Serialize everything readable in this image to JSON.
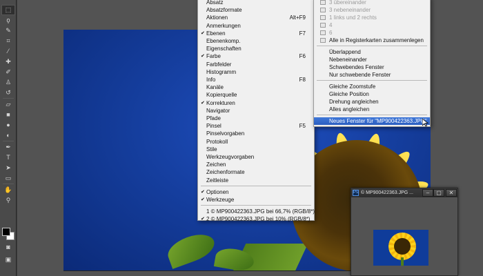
{
  "toolbar": {
    "tools": [
      {
        "name": "marquee-tool-icon",
        "glyph": "⬚"
      },
      {
        "name": "lasso-tool-icon",
        "glyph": "ϙ"
      },
      {
        "name": "quick-select-tool-icon",
        "glyph": "✎"
      },
      {
        "name": "crop-tool-icon",
        "glyph": "⌗"
      },
      {
        "name": "eyedropper-tool-icon",
        "glyph": "⁄"
      },
      {
        "name": "healing-brush-tool-icon",
        "glyph": "✚"
      },
      {
        "name": "brush-tool-icon",
        "glyph": "✐"
      },
      {
        "name": "clone-stamp-tool-icon",
        "glyph": "♙"
      },
      {
        "name": "history-brush-tool-icon",
        "glyph": "↺"
      },
      {
        "name": "eraser-tool-icon",
        "glyph": "▱"
      },
      {
        "name": "gradient-tool-icon",
        "glyph": "■"
      },
      {
        "name": "blur-tool-icon",
        "glyph": "●"
      },
      {
        "name": "dodge-tool-icon",
        "glyph": "◐"
      },
      {
        "name": "pen-tool-icon",
        "glyph": "✒"
      },
      {
        "name": "type-tool-icon",
        "glyph": "T"
      },
      {
        "name": "path-selection-tool-icon",
        "glyph": "➤"
      },
      {
        "name": "shape-tool-icon",
        "glyph": "▭"
      },
      {
        "name": "hand-tool-icon",
        "glyph": "✋"
      },
      {
        "name": "zoom-tool-icon",
        "glyph": "⚲"
      }
    ],
    "bottom_tools": [
      {
        "name": "quick-mask-icon",
        "glyph": "◙"
      },
      {
        "name": "screen-mode-icon",
        "glyph": "▣"
      }
    ]
  },
  "window_menu": {
    "items": [
      {
        "label": "Absatz",
        "shortcut": "",
        "checked": false
      },
      {
        "label": "Absatzformate",
        "shortcut": "",
        "checked": false
      },
      {
        "label": "Aktionen",
        "shortcut": "Alt+F9",
        "checked": false
      },
      {
        "label": "Anmerkungen",
        "shortcut": "",
        "checked": false
      },
      {
        "label": "Ebenen",
        "shortcut": "F7",
        "checked": true
      },
      {
        "label": "Ebenenkomp.",
        "shortcut": "",
        "checked": false
      },
      {
        "label": "Eigenschaften",
        "shortcut": "",
        "checked": false
      },
      {
        "label": "Farbe",
        "shortcut": "F6",
        "checked": true
      },
      {
        "label": "Farbfelder",
        "shortcut": "",
        "checked": false
      },
      {
        "label": "Histogramm",
        "shortcut": "",
        "checked": false
      },
      {
        "label": "Info",
        "shortcut": "F8",
        "checked": false
      },
      {
        "label": "Kanäle",
        "shortcut": "",
        "checked": false
      },
      {
        "label": "Kopierquelle",
        "shortcut": "",
        "checked": false
      },
      {
        "label": "Korrekturen",
        "shortcut": "",
        "checked": true
      },
      {
        "label": "Navigator",
        "shortcut": "",
        "checked": false
      },
      {
        "label": "Pfade",
        "shortcut": "",
        "checked": false
      },
      {
        "label": "Pinsel",
        "shortcut": "F5",
        "checked": false
      },
      {
        "label": "Pinselvorgaben",
        "shortcut": "",
        "checked": false
      },
      {
        "label": "Protokoll",
        "shortcut": "",
        "checked": false
      },
      {
        "label": "Stile",
        "shortcut": "",
        "checked": false
      },
      {
        "label": "Werkzeugvorgaben",
        "shortcut": "",
        "checked": false
      },
      {
        "label": "Zeichen",
        "shortcut": "",
        "checked": false
      },
      {
        "label": "Zeichenformate",
        "shortcut": "",
        "checked": false
      },
      {
        "label": "Zeitleiste",
        "shortcut": "",
        "checked": false
      }
    ],
    "items2": [
      {
        "label": "Optionen",
        "shortcut": "",
        "checked": true
      },
      {
        "label": "Werkzeuge",
        "shortcut": "",
        "checked": true
      }
    ],
    "documents": [
      {
        "label": "1 © MP900422363.JPG bei 66,7% (RGB/8*)",
        "checked": false
      },
      {
        "label": "2 © MP900422363.JPG bei 10% (RGB/8*)",
        "checked": true
      }
    ]
  },
  "arrange_menu": {
    "layouts": [
      {
        "label": "3 übereinander",
        "disabled": true
      },
      {
        "label": "3 nebeneinander",
        "disabled": true
      },
      {
        "label": "1 links und 2 rechts",
        "disabled": true
      },
      {
        "label": "4",
        "disabled": true
      },
      {
        "label": "6",
        "disabled": true
      },
      {
        "label": "Alle in Registerkarten zusammenlegen",
        "disabled": false
      }
    ],
    "group2": [
      "Überlappend",
      "Nebeneinander",
      "Schwebendes Fenster",
      "Nur schwebende Fenster"
    ],
    "group3": [
      "Gleiche Zoomstufe",
      "Gleiche Position",
      "Drehung angleichen",
      "Alles angleichen"
    ],
    "new_window": "Neues Fenster für \"MP900422363.JPG\""
  },
  "navigator_window": {
    "app_badge": "Ps",
    "title": "© MP900422363.JPG ...",
    "minimize": "–",
    "maximize": "▢",
    "close": "✕"
  }
}
